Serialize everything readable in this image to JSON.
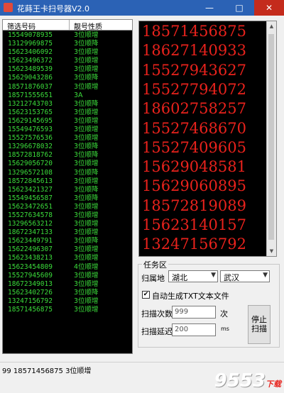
{
  "window": {
    "title": "花蒔王卡扫号器V2.0",
    "minimize": "—",
    "maximize": "□",
    "close": "✕"
  },
  "list": {
    "headers": [
      "筛选号码",
      "靓号性质"
    ],
    "rows": [
      [
        "15549078935",
        "3位顺增"
      ],
      [
        "13129969875",
        "3位顺降"
      ],
      [
        "15623406092",
        "3位顺增"
      ],
      [
        "15623496372",
        "3位顺增"
      ],
      [
        "15623489539",
        "3位顺增"
      ],
      [
        "15629043286",
        "3位顺降"
      ],
      [
        "18571876037",
        "3位顺增"
      ],
      [
        "18571555651",
        "3A"
      ],
      [
        "13212743703",
        "3位顺降"
      ],
      [
        "15623153765",
        "3位顺增"
      ],
      [
        "15629145695",
        "3位顺增"
      ],
      [
        "15549476593",
        "3位顺增"
      ],
      [
        "15527576536",
        "3位顺增"
      ],
      [
        "13296678032",
        "3位顺降"
      ],
      [
        "18572818762",
        "3位顺降"
      ],
      [
        "15629056720",
        "3位顺增"
      ],
      [
        "13296572108",
        "3位顺降"
      ],
      [
        "18572845613",
        "3位顺增"
      ],
      [
        "15623421327",
        "3位顺降"
      ],
      [
        "15549456587",
        "3位顺降"
      ],
      [
        "15623472651",
        "3位顺增"
      ],
      [
        "15527634578",
        "3位顺增"
      ],
      [
        "13296563212",
        "3位顺增"
      ],
      [
        "18672347133",
        "3位顺增"
      ],
      [
        "15623449791",
        "3位顺降"
      ],
      [
        "15622496307",
        "3位顺增"
      ],
      [
        "15623438213",
        "3位顺增"
      ],
      [
        "15623454809",
        "4位顺增"
      ],
      [
        "15527945609",
        "3位顺增"
      ],
      [
        "18672349013",
        "3位顺增"
      ],
      [
        "15623402726",
        "3位顺降"
      ],
      [
        "13247156792",
        "3位顺增"
      ],
      [
        "18571456875",
        "3位顺增"
      ]
    ]
  },
  "big_numbers": [
    "18571456875",
    "18627140933",
    "15527943627",
    "15527794072",
    "18602758257",
    "15527468670",
    "15527409605",
    "15629048581",
    "15629060895",
    "18572819089",
    "15623140157",
    "13247156792"
  ],
  "task": {
    "group_label": "任务区",
    "region_label": "归属地",
    "province": "湖北",
    "city": "武汉",
    "auto_txt_checked": true,
    "auto_txt_label": "自动生成TXT文本文件",
    "scan_count_label": "扫描次数",
    "scan_count_value": "999",
    "scan_count_unit": "次",
    "scan_delay_label": "扫描延迟",
    "scan_delay_value": "200",
    "scan_delay_unit": "ms",
    "stop_button_line1": "停止",
    "stop_button_line2": "扫描"
  },
  "status": {
    "text": "99  18571456875  3位顺增"
  },
  "watermark": {
    "big": "9553",
    "small": "下载"
  }
}
